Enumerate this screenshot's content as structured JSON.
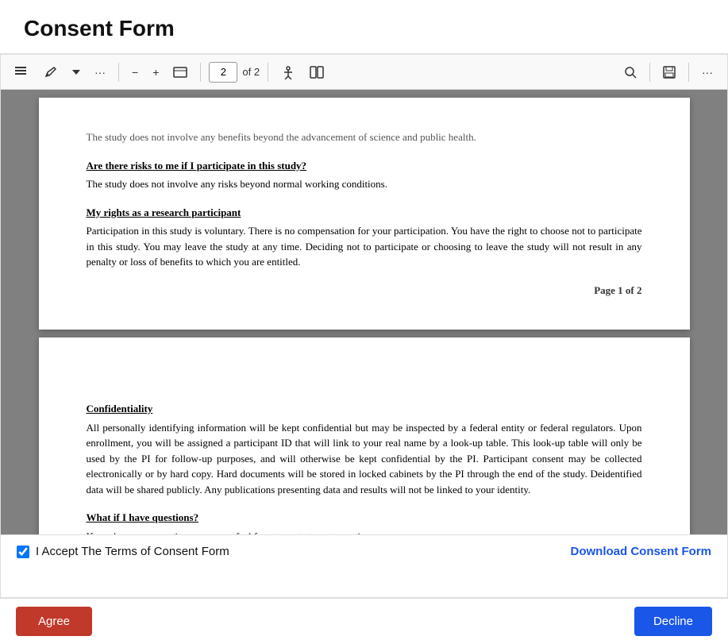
{
  "page": {
    "title": "Consent Form"
  },
  "toolbar": {
    "current_page": "2",
    "total_pages": "of 2",
    "zoom_in": "+",
    "zoom_out": "−",
    "more_options": "···"
  },
  "document": {
    "page1": {
      "cut_text": "The study does not involve any benefits beyond the advancement of science and public health.",
      "section1_heading": "Are there risks to me if I participate in this study?",
      "section1_body": "The study does not involve any risks beyond normal working conditions.",
      "section2_heading": "My rights as a research participant",
      "section2_body": "Participation in this study is voluntary. There is no compensation for your participation. You have the right to choose not to participate in this study.  You may leave the study at any time.  Deciding not to participate or choosing to leave the study will not result in any penalty or loss of benefits to which you are entitled.",
      "page_indicator_prefix": "Page ",
      "page_indicator_current": "1",
      "page_indicator_sep": " of ",
      "page_indicator_total": "2"
    },
    "page2": {
      "section3_heading": "Confidentiality",
      "section3_body": "All personally identifying information will be kept confidential but may be inspected by a federal entity or federal regulators. Upon enrollment, you will be assigned a participant ID that will link to your real name by a look-up table. This look-up table will only be used by the PI for follow-up purposes, and will otherwise be kept confidential by the PI. Participant consent may be collected electronically or by hard copy. Hard documents will be stored in locked cabinets by the PI through the end of the study. Deidentified data will be shared publicly. Any publications presenting data and results will not be linked to your identity.",
      "section4_heading": "What if I have questions?",
      "section4_body_partial": "If you have any questions, you may feel free to contact us at any time..."
    }
  },
  "footer": {
    "checkbox_label": "I Accept The Terms of Consent Form",
    "download_label": "Download Consent Form"
  },
  "actions": {
    "agree_label": "Agree",
    "decline_label": "Decline"
  }
}
